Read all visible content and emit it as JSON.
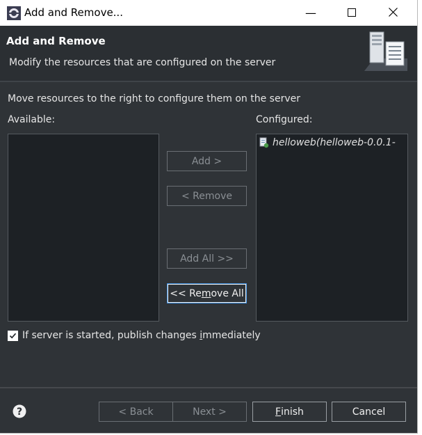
{
  "window": {
    "title": "Add and Remove...",
    "controls": {
      "minimize": "—",
      "maximize": "☐",
      "close": "✕"
    }
  },
  "header": {
    "title": "Add and Remove",
    "description": "Modify the resources that are configured on the server"
  },
  "body": {
    "instruction": "Move resources to the right to configure them on the server",
    "available_label": "Available:",
    "configured_label": "Configured:",
    "available_items": [],
    "configured_items": [
      {
        "label": "helloweb(helloweb-0.0.1-",
        "icon": "web-module-icon"
      }
    ]
  },
  "buttons": {
    "add": {
      "label": "Add >",
      "enabled": false
    },
    "remove": {
      "label": "< Remove",
      "enabled": false
    },
    "add_all": {
      "label": "Add All >>",
      "enabled": false
    },
    "remove_all": {
      "pre": "<< Re",
      "mnemonic": "m",
      "post": "ove All",
      "enabled": true
    }
  },
  "publish_checkbox": {
    "checked": true,
    "label_pre": "If server is started, publish changes ",
    "label_mnemonic": "i",
    "label_post": "mmediately"
  },
  "footer": {
    "help_icon": "question-icon",
    "back": {
      "label": "< Back",
      "enabled": false
    },
    "next": {
      "label": "Next >",
      "enabled": false
    },
    "finish": {
      "mnemonic": "F",
      "post": "inish",
      "enabled": true
    },
    "cancel": {
      "label": "Cancel",
      "enabled": true
    }
  },
  "colors": {
    "background": "#2f3337",
    "list_background": "#1d2125",
    "focus_border": "#3e8ede"
  }
}
